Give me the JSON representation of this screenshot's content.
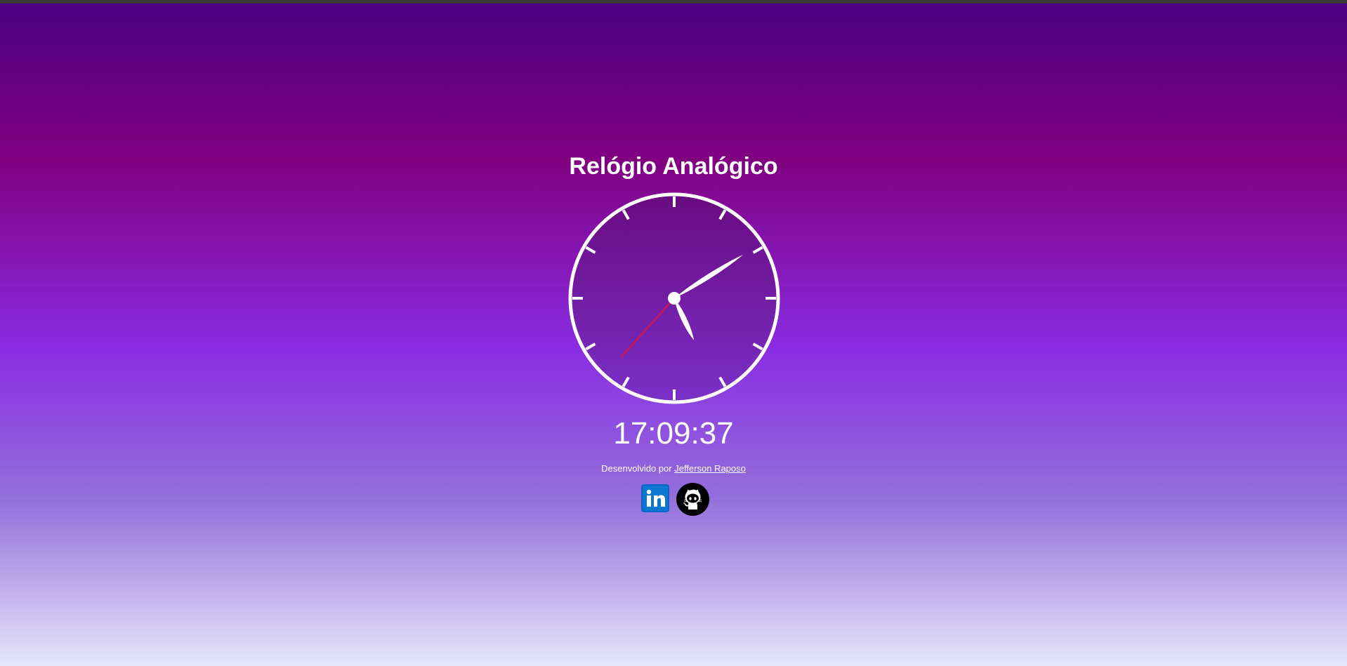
{
  "page": {
    "title": "Relógio Analógico",
    "digital_time": "17:09:37",
    "credit_prefix": "Desenvolvido por",
    "credit_author": "Jefferson Raposo"
  },
  "clock": {
    "hours": 17,
    "minutes": 9,
    "seconds": 37,
    "hand_color": "#ffffff",
    "second_hand_color": "#dc143c"
  },
  "socials": {
    "linkedin_icon": "linkedin-icon",
    "linkedin_color": "#0a66c2",
    "github_icon": "github-icon",
    "github_color": "#000000"
  }
}
